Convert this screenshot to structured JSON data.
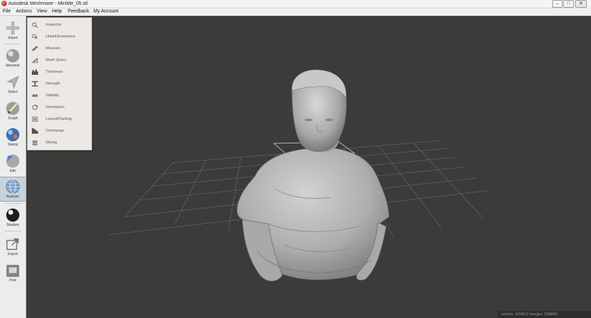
{
  "window": {
    "title": "Autodesk Meshmixer - MiniMe_05.stl",
    "controls": {
      "minimize": "–",
      "maximize": "□",
      "close": "✕"
    }
  },
  "menubar": {
    "items": [
      "File",
      "Actions",
      "View",
      "Help",
      "Feedback",
      "My Account"
    ]
  },
  "toolbar": {
    "items": [
      {
        "label": "Import",
        "icon": "plus-icon"
      },
      {
        "label": "Meshmix",
        "icon": "meshmix-sphere-icon"
      },
      {
        "label": "Select",
        "icon": "select-arrow-icon"
      },
      {
        "label": "Sculpt",
        "icon": "sculpt-brush-icon"
      },
      {
        "label": "Stamp",
        "icon": "stamp-icon"
      },
      {
        "label": "Edit",
        "icon": "edit-icon"
      },
      {
        "label": "Analysis",
        "icon": "analysis-globe-icon",
        "active": true
      },
      {
        "label": "Shaders",
        "icon": "shader-sphere-icon"
      },
      {
        "label": "Export",
        "icon": "export-icon"
      },
      {
        "label": "Print",
        "icon": "print-icon"
      }
    ]
  },
  "analysis_menu": {
    "items": [
      {
        "label": "Inspector",
        "icon": "magnifier-icon"
      },
      {
        "label": "Units/Dimensions",
        "icon": "units-icon"
      },
      {
        "label": "Measure",
        "icon": "ruler-icon"
      },
      {
        "label": "Mesh Query",
        "icon": "mesh-query-icon"
      },
      {
        "label": "Thickness",
        "icon": "thickness-icon"
      },
      {
        "label": "Strength",
        "icon": "strength-icon"
      },
      {
        "label": "Stability",
        "icon": "stability-icon"
      },
      {
        "label": "Orientation",
        "icon": "orientation-icon"
      },
      {
        "label": "Layout/Packing",
        "icon": "layout-packing-icon"
      },
      {
        "label": "Overhangs",
        "icon": "overhangs-icon"
      },
      {
        "label": "Slicing",
        "icon": "slicing-icon"
      }
    ]
  },
  "status": {
    "text": "vertices: 1184512 triangles: 2368450"
  },
  "colors": {
    "viewport": "#3b3b3b",
    "grid": "#8a8a8a",
    "model": "#b4b4b4",
    "active_tool": "#c8d2dc"
  }
}
